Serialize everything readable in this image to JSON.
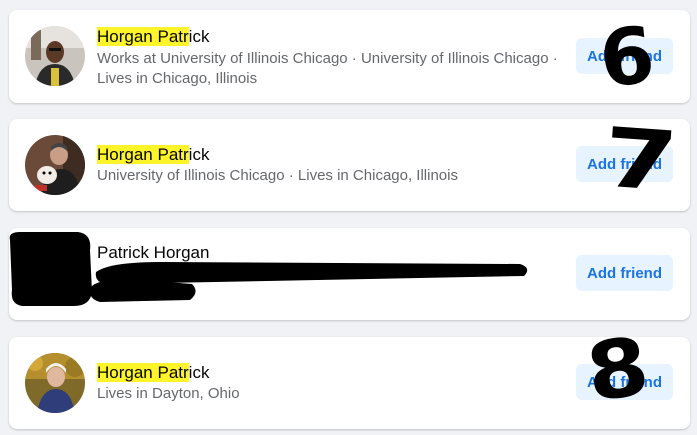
{
  "results": [
    {
      "name_highlight": "Horgan Patr",
      "name_rest": "ick",
      "detail_lines": [
        "Works at University of Illinois Chicago · University of Illinois Chicago ·",
        "Lives in Chicago, Illinois"
      ],
      "button": "Add friend",
      "handwritten_number": "6"
    },
    {
      "name_highlight": "Horgan Patr",
      "name_rest": "ick",
      "detail_lines": [
        "University of Illinois Chicago · Lives in Chicago, Illinois"
      ],
      "button": "Add friend",
      "handwritten_number": "7"
    },
    {
      "name_highlight": "",
      "name_rest": "Patrick Horgan",
      "detail_lines": [],
      "button": "Add friend",
      "handwritten_number": ""
    },
    {
      "name_highlight": "Horgan Patr",
      "name_rest": "ick",
      "detail_lines": [
        "Lives in Dayton, Ohio"
      ],
      "button": "Add friend",
      "handwritten_number": "8"
    }
  ],
  "colors": {
    "highlight": "#fdf52a",
    "button_bg": "#e7f3ff",
    "button_text": "#1b74e4",
    "page_bg": "#f0f2f5"
  }
}
